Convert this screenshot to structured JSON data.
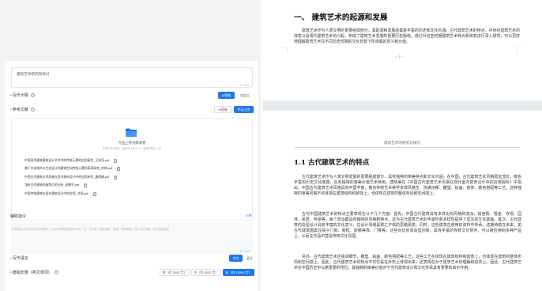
{
  "form": {
    "title_value": "建筑艺术研究和探讨",
    "title_counter": "9 / 100",
    "outline": {
      "label": "写作大纲",
      "help": "?",
      "mode_ai": "AI智能",
      "mode_custom": "自定义"
    },
    "references": {
      "label": "参考文献",
      "help": "?",
      "mode_smart": "AI智能",
      "mode_manual": "手动上传",
      "upload_title": "点击上传文献或者",
      "upload_tip": "仅限于学术资料，最多可上传 5 个，支持扩展名：pdf",
      "files": [
        "中国现代建筑建筑设计艺术中的传统元素的应用研究_王宏亮.pdf",
        "基于文化结构与生态设计的建筑空间传统元素的表现研究_刘帅.pdf",
        "中国古代建筑艺术风格在室内装饰设计中的应用研究_唐丽娟.pdf",
        "浅析古代建筑构造特点的分析_张鹏宇.pdf",
        "中国传统建筑在现代建筑设计中的应用_刘慧.pdf"
      ]
    },
    "prompt": {
      "label": "辅助指令",
      "link": "示例",
      "placeholder": "请详细输入你对生成内容的要求，比如文章需要更加学术化、论、可分析、理论数据、表述、案例数据、加入论证思路、形式层级结构",
      "counter": "0 / 500"
    },
    "language": {
      "label": "写作语言",
      "opt_zh": "中文",
      "opt_en": "英文"
    },
    "length": {
      "label": "篇幅长度（英文单词）",
      "help": "?",
      "opt_short": "短（约 3000 字）",
      "opt_medium": "中（约 6000 字）",
      "opt_long": "长（约 10000 字）"
    }
  },
  "preview": {
    "section_heading": "一、 建筑艺术的起源和发展",
    "intro_paragraph": "建筑艺术作为人类文明的重要组成部分，其起源和发展承载着丰富的历史和文化内涵。古代建筑艺术的特点、中世纪建筑艺术的演变以及现代建筑艺术的兴起，构成了建筑艺术发展的重要历史脉络。通过对这些时期建筑艺术特点和演变进行深入研究，可以更好地理解建筑艺术在不同历史时期的文化背景下所承载的意义和价值。",
    "page_number": "-- 1 --",
    "running_header": "建筑艺术的研究与探讨",
    "sub_heading": "1.1 古代建筑艺术的特点",
    "paragraphs": [
      "古代建筑艺术作为人类文明发展的重要组成部分，具有独特的审美特点和文化内涵。在中国，古代建筑艺术风格源远流长，蕴含丰富的历史文化底蕴，具有独特的审美价值艺术特色。唐晓美在《中国古代建筑艺术风格在现代室内装饰设计中的应用探析》中指出，中国古代建筑艺术风格具有中国丰富，蕴含传统艺术美学多样风格生，饱满浓郁、雕塑、绘画、装饰、颜色搭配等工艺。这种独特的审美风格不仅体现在建筑结构和装饰上，也体现在建筑的整体布局和空间感上。",
      "古代中国建筑艺术的特点主要表现在以下几个方面：首先，中国古代建筑具有多样化的风格和流派，如宫殿、祖庙、寺观、园林、民居、桥梁等，每个流派都具有独特的风格和特点，这为古代建筑艺术的丰富性和多样性提供了坚实的文化基础。其次，古代建筑的造型设计具有丰富的文化意义，在设计领域是取之不竭的思路源泉。同时，这些建筑在使用的资料中传承，还期待着在未来，如古代建筑图案在镜子门窗、窗框、屋檐等饰、门楼等，这些对比创意造型创新，具有丰富的传统文化情怀，可以被应用到多种产品上，从而在作品中营造传统文化氛围。",
      "另外，古代建筑艺术还强调细节，雕塑、绘画、颜色搭配等工艺，这些工艺在体现在建筑结构和装饰上，也体现在建筑的整体布局和空间感上。因此，古代建筑艺术的特点不仅仅是在外形上体现出来，还表现在对于建筑艺术的理解和追求上。因此，古代建筑艺术在中国历史中占据重要的地位，其独特的审美价值对于当代建筑设计和文化传承具有重要的启示作用。"
    ]
  },
  "colors": {
    "primary": "#1d76f2",
    "required": "#e03a3a",
    "panel_bg": "#f2f3f5",
    "doc_gap": "#e9ecef"
  }
}
